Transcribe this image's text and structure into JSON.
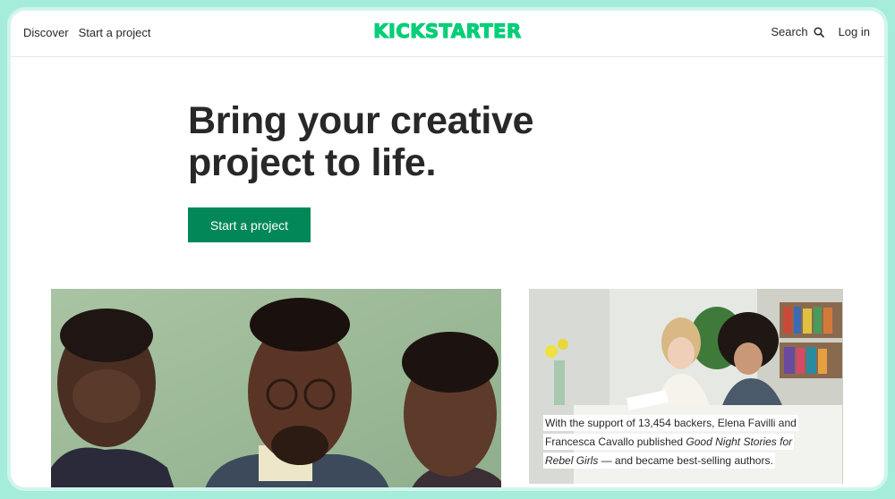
{
  "nav": {
    "discover": "Discover",
    "start_project": "Start a project",
    "logo": "KICKSTARTER",
    "search": "Search",
    "login": "Log in"
  },
  "hero": {
    "line1": "Bring your creative",
    "line2": "project to life.",
    "cta": "Start a project"
  },
  "caption": {
    "part1": "With the support of 13,454 backers, Elena Favilli and Francesca Cavallo published ",
    "title": "Good Night Stories for Rebel Girls",
    "part2": " — and became best-selling authors."
  },
  "colors": {
    "brand_green": "#05ce78",
    "button_green": "#028858",
    "frame_mint": "#a6ecdb"
  },
  "icons": {
    "search": "search-icon"
  }
}
